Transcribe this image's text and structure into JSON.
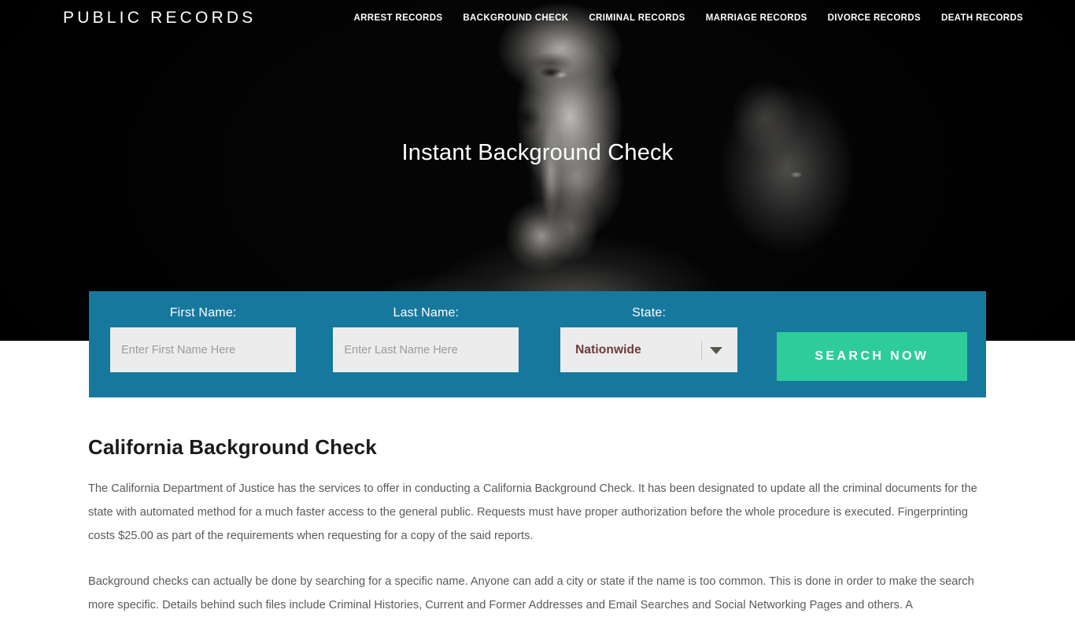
{
  "header": {
    "brand": "PUBLIC RECORDS",
    "nav_items": [
      {
        "label": "ARREST RECORDS"
      },
      {
        "label": "BACKGROUND CHECK"
      },
      {
        "label": "CRIMINAL RECORDS"
      },
      {
        "label": "MARRIAGE RECORDS"
      },
      {
        "label": "DIVORCE RECORDS"
      },
      {
        "label": "DEATH RECORDS"
      }
    ]
  },
  "hero": {
    "title": "Instant Background Check",
    "background_color": "#000000",
    "image_description": "black-and-white photo of a man holding a finger to his lips"
  },
  "search_form": {
    "panel_color": "#17789e",
    "first_name": {
      "label": "First Name:",
      "placeholder": "Enter First Name Here",
      "value": ""
    },
    "last_name": {
      "label": "Last Name:",
      "placeholder": "Enter Last Name Here",
      "value": ""
    },
    "state": {
      "label": "State:",
      "selected": "Nationwide"
    },
    "submit": {
      "label": "SEARCH NOW",
      "color": "#2ecc9b"
    }
  },
  "article": {
    "title": "California Background Check",
    "paragraphs": [
      "The California Department of Justice has the services to offer in conducting a California Background Check. It has been designated to update all the criminal documents for the state with automated method for a much faster access to the general public. Requests must have proper authorization before the whole procedure is executed. Fingerprinting costs $25.00 as part of the requirements when requesting for a copy of the said reports.",
      "Background checks can actually be done by searching for a specific name. Anyone can add a city or state if the name is too common. This is done in order to make the search more specific. Details behind such files include Criminal Histories, Current and Former Addresses and Email Searches and Social Networking Pages and others. A"
    ]
  }
}
